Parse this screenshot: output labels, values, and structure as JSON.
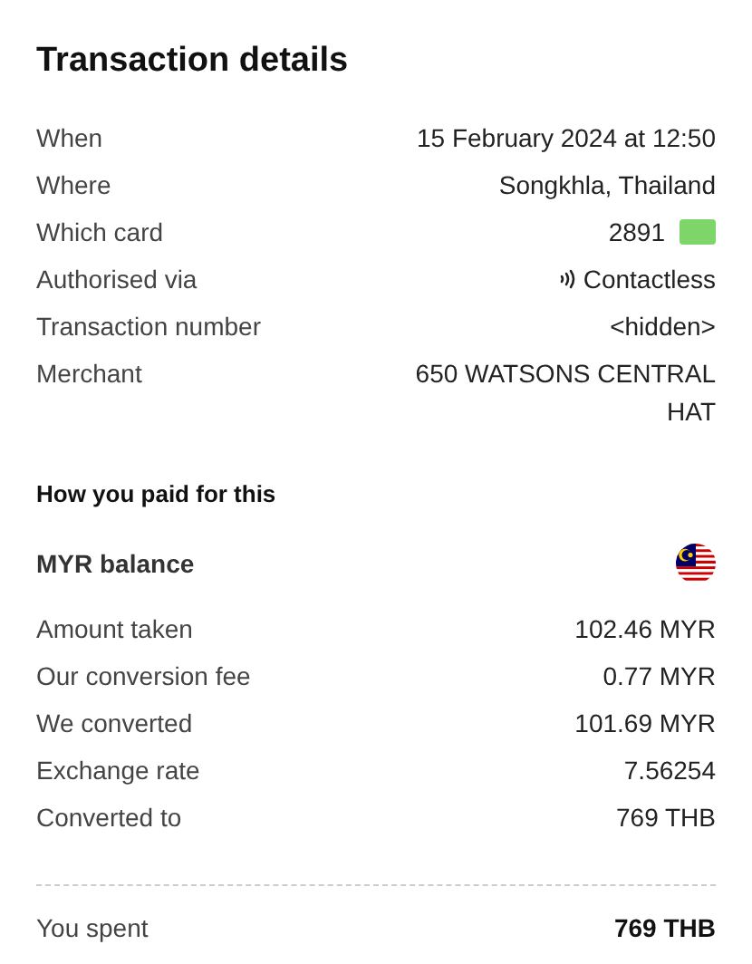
{
  "title": "Transaction details",
  "details": [
    {
      "label": "When",
      "value": "15 February 2024 at 12:50",
      "kind": "text"
    },
    {
      "label": "Where",
      "value": "Songkhla, Thailand",
      "kind": "text"
    },
    {
      "label": "Which card",
      "value": "2891",
      "kind": "card",
      "color": "#7ed66b"
    },
    {
      "label": "Authorised via",
      "value": "Contactless",
      "kind": "contactless"
    },
    {
      "label": "Transaction number",
      "value": "<hidden>",
      "kind": "text"
    },
    {
      "label": "Merchant",
      "value": "650 WATSONS CENTRAL HAT",
      "kind": "text"
    }
  ],
  "payment_heading": "How you paid for this",
  "balance": {
    "name": "MYR balance"
  },
  "payment_rows": [
    {
      "label": "Amount taken",
      "value": "102.46 MYR"
    },
    {
      "label": "Our conversion fee",
      "value": "0.77 MYR"
    },
    {
      "label": "We converted",
      "value": "101.69 MYR"
    },
    {
      "label": "Exchange rate",
      "value": "7.56254"
    },
    {
      "label": "Converted to",
      "value": "769 THB"
    }
  ],
  "total": {
    "label": "You spent",
    "value": "769 THB"
  }
}
